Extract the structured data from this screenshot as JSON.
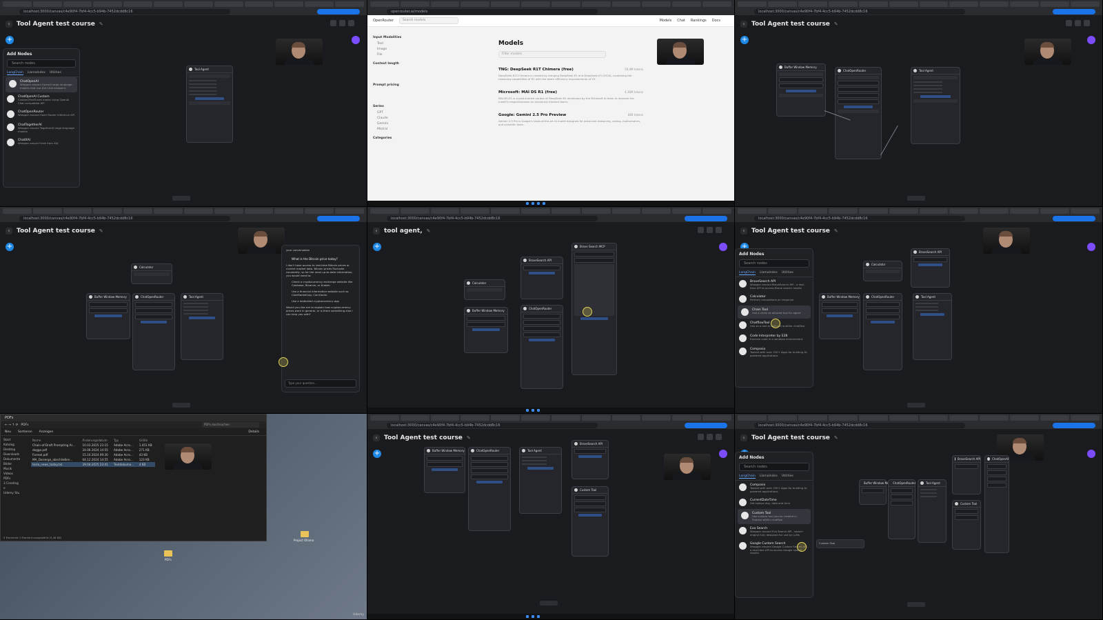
{
  "flow_title": "Tool Agent test course",
  "flow_title_alt": "tool agent,",
  "address_bar": "localhost:3000/canvas/c4e90f4-7bf4-4cc5-b94b-7452dcdd8c16",
  "add_nodes": {
    "title": "Add Nodes",
    "search_placeholder": "Search nodes",
    "tabs": [
      "LangChain",
      "LlamaIndex",
      "Utilities"
    ]
  },
  "panel1_items": [
    {
      "title": "ChatOpenAI",
      "desc": "Wrapper around OpenAI large language models that use the Chat endpoint"
    },
    {
      "title": "ChatOpenAI Custom",
      "desc": "Custom/FineTuned model using OpenAI Chat compatible API"
    },
    {
      "title": "ChatOpenRouter",
      "desc": "Wrapper around Open Router Inference API"
    },
    {
      "title": "ChatTogetherAI",
      "desc": "Wrapper around TogetherAI large language models"
    },
    {
      "title": "ChatXAI",
      "desc": "Wrapper around Grok from XAI"
    }
  ],
  "panel2_items": [
    {
      "title": "BraveSearch API",
      "desc": "Wrapper around BraveSearch API - a real-time API to access Brave search results"
    },
    {
      "title": "Calculator",
      "desc": "Perform calculations on response"
    },
    {
      "title": "Chain Tool",
      "desc": "Use a chain as allowed tool for agent"
    },
    {
      "title": "ChatflowTool",
      "desc": "Use as a tool to execute another chatflow"
    },
    {
      "title": "Code Interpreter by E2B",
      "desc": "Execute code in a sandbox environment"
    },
    {
      "title": "Composio",
      "desc": "Toolset with over 250+ Apps for building AI-powered applications"
    }
  ],
  "panel3_items": [
    {
      "title": "Composio",
      "desc": "Toolset with over 250+ Apps for building AI-powered applications"
    },
    {
      "title": "CurrentDateTime",
      "desc": "Get todays day, date and time"
    },
    {
      "title": "Custom Tool",
      "desc": "Use custom tool you've created in Flowise within chatflow"
    },
    {
      "title": "Exa Search",
      "desc": "Wrapper around Exa Search API - search engine fully designed for use by LLMs"
    },
    {
      "title": "Google Custom Search",
      "desc": "Wrapper around Google Custom Search API - a real-time API to access Google search results"
    }
  ],
  "nodes": {
    "tool_agent": "Tool Agent",
    "buffer_memory": "Buffer Window Memory",
    "chat_openai": "ChatOpenRouter",
    "calculator": "Calculator",
    "brave": "BraveSearch API",
    "brave_mcp": "Brave Search MCP",
    "custom_tool": "Custom Tool",
    "chat_openai_node": "ChatOpenAI"
  },
  "openrouter": {
    "brand": "OpenRouter",
    "search_placeholder": "Search models",
    "nav": [
      "Models",
      "Chat",
      "Rankings",
      "Docs"
    ],
    "filters": [
      "Input Modalities",
      "Context length",
      "Prompt pricing",
      "Series",
      "Categories"
    ],
    "modalities": [
      "Text",
      "Image",
      "File"
    ],
    "series": [
      "GPT",
      "Claude",
      "Gemini",
      "Mistral"
    ],
    "title": "Models",
    "filter_placeholder": "Filter models",
    "models": [
      {
        "name": "TNG: DeepSeek R1T Chimera (free)",
        "tokens": "59.4M tokens",
        "desc": "DeepSeek-R1T-Chimera is created by merging DeepSeek-R1 and DeepSeek-V3 (0324), combining the reasoning capabilities of R1 with the token efficiency improvements of V3."
      },
      {
        "name": "Microsoft: MAI DS R1 (free)",
        "tokens": "4.36M tokens",
        "desc": "MAI-DS-R1 is a post-trained variant of DeepSeek-R1 developed by the Microsoft AI team to improve the model's responsiveness on previously blocked topics."
      },
      {
        "name": "Google: Gemini 2.5 Pro Preview",
        "tokens": "880 tokens",
        "desc": "Gemini 2.5 Pro is Google's state-of-the-art AI model designed for advanced reasoning, coding, mathematics, and scientific tasks."
      }
    ]
  },
  "chat": {
    "header": "your conversation",
    "question": "What is the Bitcoin price today?",
    "answer": "I don't have access to real-time Bitcoin prices or current market data. Bitcoin prices fluctuate constantly, so for the most up-to-date information, you would need to:",
    "steps": [
      "Check a cryptocurrency exchange website like Coinbase, Binance, or Kraken",
      "Use a financial information website such as CoinMarketCap, CoinGecko",
      "Use a dedicated cryptocurrency app"
    ],
    "followup": "Would you like me to explain how cryptocurrency prices work in general, or is there something else I can help you with?",
    "input_placeholder": "Type your question..."
  },
  "explorer": {
    "window_title": "PDFs",
    "path": "PDFs",
    "search_placeholder": "PDFs durchsuchen",
    "toolbar": [
      "Neu",
      "Sortieren",
      "Anzeigen",
      "Details"
    ],
    "columns": [
      "Name",
      "Änderungsdatum",
      "Typ",
      "Größe"
    ],
    "files": [
      {
        "name": "Chain-of-Draft Prompting Ar...",
        "date": "10.03.2025 23:15",
        "type": "Adobe Acro...",
        "size": "1.451 KB"
      },
      {
        "name": "doggo.pdf",
        "date": "24.06.2024 14:55",
        "type": "Adobe Acro...",
        "size": "271 KB"
      },
      {
        "name": "Formel.pdf",
        "date": "15.10.2024 09:30",
        "type": "Adobe Acro...",
        "size": "43 KB"
      },
      {
        "name": "MA_Dosierge_abschließen...",
        "date": "04.12.2024 14:55",
        "type": "Adobe Acro...",
        "size": "123 KB"
      },
      {
        "name": "tesla_news_today.txt",
        "date": "29.04.2025 23:41",
        "type": "Textdokume...",
        "size": "4 KB"
      }
    ],
    "sidebar": [
      "Start",
      "Katalog",
      "Desktop",
      "Downloads",
      "Dokumente",
      "Bilder",
      "Musik",
      "Videos",
      "PDFs",
      "3 Creating",
      "e",
      "Udemy Stu"
    ],
    "status": "5 Elemente   1 Element ausgewählt (3,46 KB)",
    "desktop_folders": [
      "Project Ollama",
      "PDFs"
    ]
  },
  "watermark": "Udemy"
}
